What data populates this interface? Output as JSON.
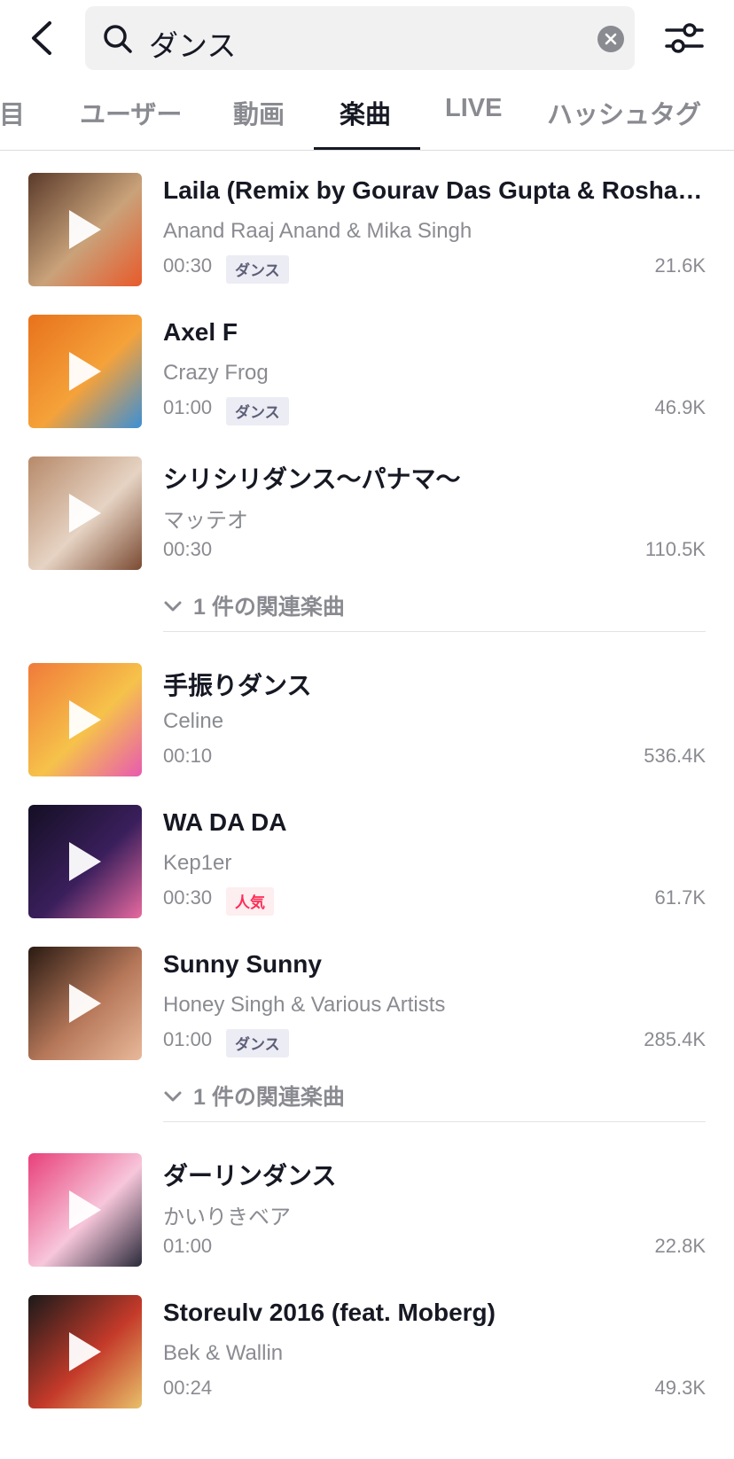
{
  "search": {
    "query": "ダンス"
  },
  "tabs": [
    {
      "label": "注目"
    },
    {
      "label": "ユーザー"
    },
    {
      "label": "動画"
    },
    {
      "label": "楽曲"
    },
    {
      "label": "LIVE"
    },
    {
      "label": "ハッシュタグ"
    }
  ],
  "active_tab": "楽曲",
  "colors": {
    "accent_hot": "#fe2c55",
    "tag_bg": "#ececf4",
    "muted_text": "#8a8b91"
  },
  "songs": [
    {
      "title": "Laila (Remix by Gourav Das Gupta & Roshan Prince)",
      "artist": "Anand Raaj Anand & Mika Singh",
      "duration": "00:30",
      "tag": "ダンス",
      "count": "21.6K",
      "cover_colors": [
        "#5a3a2a",
        "#c9a27a",
        "#e85a2a"
      ]
    },
    {
      "title": "Axel F",
      "artist": "Crazy Frog",
      "duration": "01:00",
      "tag": "ダンス",
      "count": "46.9K",
      "cover_colors": [
        "#e8721c",
        "#f5a23a",
        "#3b8fd6"
      ]
    },
    {
      "title": "シリシリダンス〜パナマ〜",
      "artist": "マッテオ",
      "duration": "00:30",
      "count": "110.5K",
      "related": "1 件の関連楽曲",
      "cover_colors": [
        "#b78a6a",
        "#e6d3c3",
        "#7a4a32"
      ]
    },
    {
      "title": "手振りダンス",
      "artist": "Celine",
      "duration": "00:10",
      "count": "536.4K",
      "cover_colors": [
        "#f07a3a",
        "#f6c24a",
        "#e85ab0"
      ]
    },
    {
      "title": "WA DA DA",
      "artist": "Kep1er",
      "duration": "00:30",
      "tag": "人気",
      "tag_style": "hot",
      "count": "61.7K",
      "cover_colors": [
        "#140f24",
        "#3a1f5c",
        "#e86aa0"
      ]
    },
    {
      "title": "Sunny Sunny",
      "artist": "Honey Singh & Various Artists",
      "duration": "01:00",
      "tag": "ダンス",
      "count": "285.4K",
      "related": "1 件の関連楽曲",
      "cover_colors": [
        "#2a1a12",
        "#b7785a",
        "#e8b89a"
      ]
    },
    {
      "title": "ダーリンダンス",
      "artist": "かいりきベア",
      "duration": "01:00",
      "count": "22.8K",
      "cover_colors": [
        "#e8407a",
        "#f7c6da",
        "#2a2a3a"
      ]
    },
    {
      "title": "Storeulv 2016 (feat. Moberg)",
      "artist": "Bek & Wallin",
      "duration": "00:24",
      "count": "49.3K",
      "cover_colors": [
        "#1a1a1a",
        "#c43a2a",
        "#e8c06a"
      ]
    }
  ]
}
